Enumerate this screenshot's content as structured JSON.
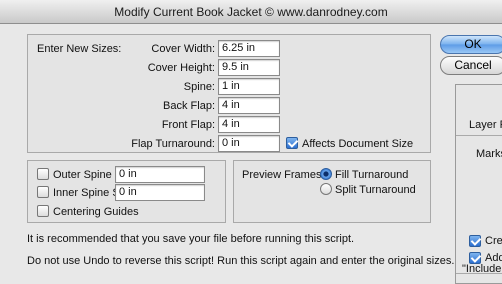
{
  "window": {
    "title": "Modify Current Book Jacket © www.danrodney.com"
  },
  "sizes": {
    "heading": "Enter New Sizes:",
    "cover_width": {
      "label": "Cover Width:",
      "value": "6.25 in"
    },
    "cover_height": {
      "label": "Cover Height:",
      "value": "9.5 in"
    },
    "spine": {
      "label": "Spine:",
      "value": "1 in"
    },
    "back_flap": {
      "label": "Back Flap:",
      "value": "4 in"
    },
    "front_flap": {
      "label": "Front Flap:",
      "value": "4 in"
    },
    "flap_turnaround": {
      "label": "Flap Turnaround:",
      "value": "0 in"
    },
    "affects_doc_label": "Affects Document Size",
    "affects_doc_checked": true
  },
  "guides": {
    "outer_spine_label": "Outer Spine Safety",
    "outer_spine_value": "0 in",
    "outer_spine_checked": false,
    "inner_spine_label": "Inner Spine Safety",
    "inner_spine_value": "0 in",
    "inner_spine_checked": false,
    "centering_label": "Centering Guides",
    "centering_checked": false
  },
  "preview": {
    "label": "Preview Frames:",
    "options": [
      "Fill Turnaround",
      "Split Turnaround"
    ],
    "selected": "Fill Turnaround"
  },
  "notes": {
    "line1": "It is recommended that you save your file before running this script.",
    "line2": "Do not use Undo to reverse this script! Run this script again and enter the original sizes."
  },
  "buttons": {
    "ok": "OK",
    "cancel": "Cancel"
  },
  "background_window": {
    "layer_label": "Layer Pr",
    "marks_label": "Marks",
    "create_label": "Crea",
    "add_label": "Add",
    "include_label": "\"Include"
  }
}
